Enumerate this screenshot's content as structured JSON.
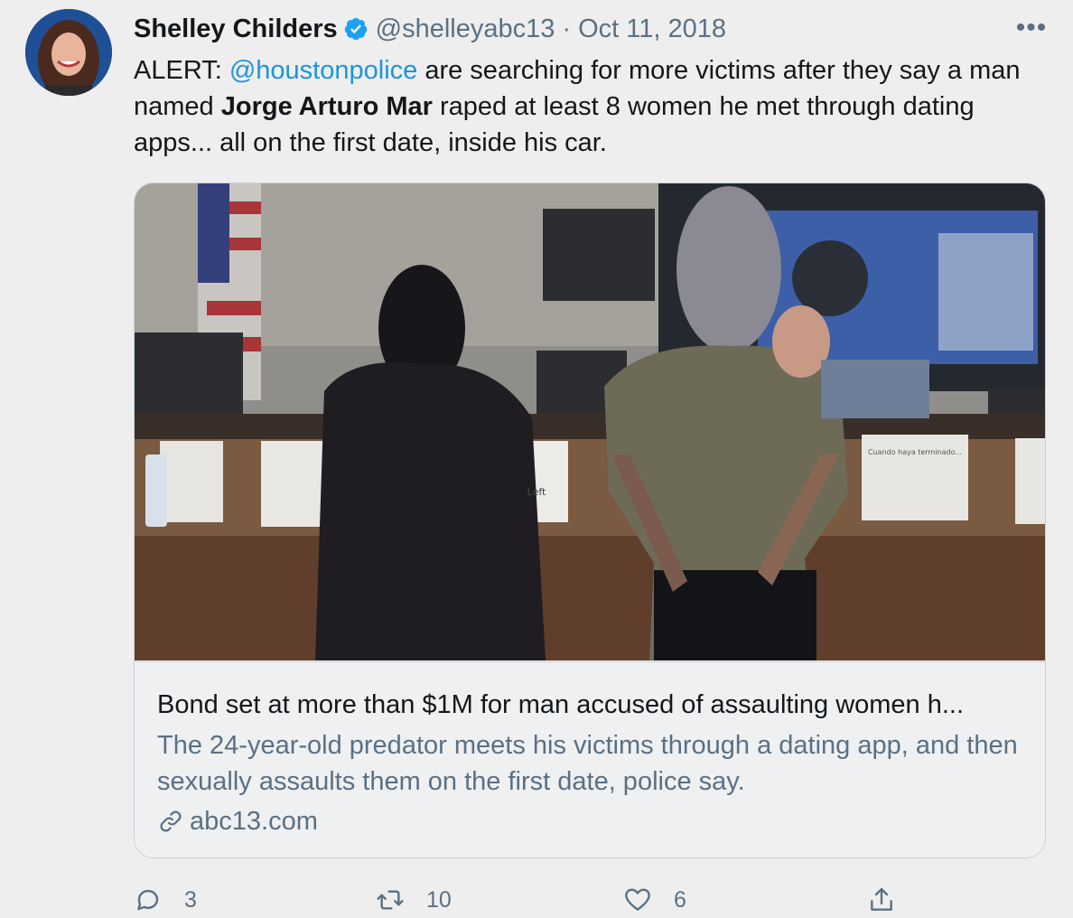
{
  "tweet": {
    "author_name": "Shelley Childers",
    "handle": "@shelleyabc13",
    "separator": "·",
    "date": "Oct 11, 2018",
    "more_label": "•••",
    "text": {
      "prefix": "ALERT: ",
      "mention": "@houstonpolice",
      "part2": " are searching for more victims after they say a man named ",
      "bold_name": "Jorge Arturo Mar",
      "part3": " raped at least 8 women he met through dating apps... all on the first date, inside his car."
    }
  },
  "card": {
    "title": "Bond set at more than $1M for man accused of assaulting women h...",
    "description": "The 24-year-old predator meets his victims through a dating app, and then sexually assaults them on the first date, police say.",
    "domain": "abc13.com",
    "image_sign_text": "Cuando haya terminado...",
    "image_left_text": "Left"
  },
  "actions": {
    "reply_count": "3",
    "retweet_count": "10",
    "like_count": "6"
  },
  "icons": {
    "verified": "verified-badge-icon",
    "reply": "reply-icon",
    "retweet": "retweet-icon",
    "like": "heart-icon",
    "share": "share-icon",
    "link": "link-icon",
    "more": "more-options-icon"
  },
  "colors": {
    "mention": "#1b95e0",
    "verified": "#1da1f2",
    "muted": "#5b7083",
    "background": "#eeeeee"
  }
}
